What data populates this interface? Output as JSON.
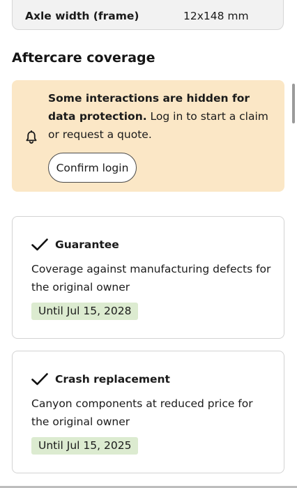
{
  "spec": {
    "label": "Axle width (frame)",
    "value": "12x148 mm"
  },
  "section": {
    "title": "Aftercare coverage"
  },
  "notice": {
    "icon": "bell-icon",
    "bold_text": "Some interactions are hidden for data protection.",
    "text": " Log in to start a claim or request a quote.",
    "button_label": "Confirm login",
    "background": "#fbe7c6"
  },
  "coverage": [
    {
      "title": "Guarantee",
      "description": "Coverage against manufacturing defects for the original owner",
      "until": "Until Jul 15, 2028",
      "icon": "check-icon"
    },
    {
      "title": "Crash replacement",
      "description": "Canyon components at reduced price for the original owner",
      "until": "Until Jul 15, 2025",
      "icon": "check-icon"
    }
  ],
  "colors": {
    "badge_background": "#dcebd0",
    "card_border": "#d3d3d3"
  }
}
